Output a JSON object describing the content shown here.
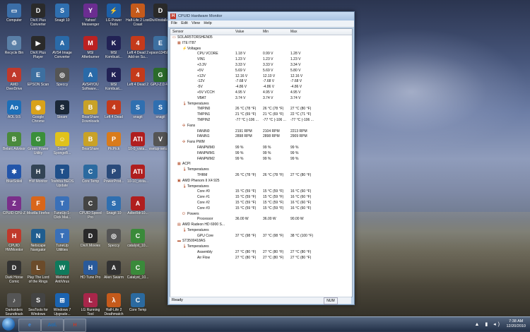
{
  "desktop_icons": [
    {
      "label": "Computer",
      "color": "#3b6ea8",
      "glyph": "▭",
      "col": 0,
      "row": 0
    },
    {
      "label": "Recycle Bin",
      "color": "#5a7fa6",
      "glyph": "♲",
      "col": 0,
      "row": 1
    },
    {
      "label": "AMD OverDrive",
      "color": "#c0392b",
      "glyph": "A",
      "col": 0,
      "row": 2
    },
    {
      "label": "AOL 9.5",
      "color": "#1d6fb8",
      "glyph": "Ao",
      "col": 0,
      "row": 3
    },
    {
      "label": "Belarc Advisor",
      "color": "#4a8a3c",
      "glyph": "B",
      "col": 0,
      "row": 4
    },
    {
      "label": "BlueSoleil",
      "color": "#2255aa",
      "glyph": "✱",
      "col": 0,
      "row": 5
    },
    {
      "label": "CPUID CPU-Z",
      "color": "#7a2f8a",
      "glyph": "Z",
      "col": 0,
      "row": 6
    },
    {
      "label": "CPUID HWMonitor",
      "color": "#c0392b",
      "glyph": "H",
      "col": 0,
      "row": 7
    },
    {
      "label": "Dark Horse Comic",
      "color": "#333333",
      "glyph": "D",
      "col": 0,
      "row": 8
    },
    {
      "label": "Darksiders Soundtrack",
      "color": "#555555",
      "glyph": "♪",
      "col": 0,
      "row": 9
    },
    {
      "label": "DivX Plus Converter",
      "color": "#2a2a2a",
      "glyph": "D",
      "col": 1,
      "row": 0
    },
    {
      "label": "DivX Plus Player",
      "color": "#2a2a2a",
      "glyph": "▶",
      "col": 1,
      "row": 1
    },
    {
      "label": "EPSON Scan",
      "color": "#3d6fa0",
      "glyph": "E",
      "col": 1,
      "row": 2
    },
    {
      "label": "Google Chrome",
      "color": "#d9a21b",
      "glyph": "◉",
      "col": 1,
      "row": 3
    },
    {
      "label": "Green Power Utility",
      "color": "#3a8f3a",
      "glyph": "G",
      "col": 1,
      "row": 4
    },
    {
      "label": "HW Monitor",
      "color": "#345",
      "glyph": "H",
      "col": 1,
      "row": 5
    },
    {
      "label": "Mozilla Firefox",
      "color": "#d9661b",
      "glyph": "F",
      "col": 1,
      "row": 6
    },
    {
      "label": "Netscape Navigator",
      "color": "#1f5d8f",
      "glyph": "N",
      "col": 1,
      "row": 7
    },
    {
      "label": "Play The Lord of the Rings",
      "color": "#6b4b2a",
      "glyph": "L",
      "col": 1,
      "row": 8
    },
    {
      "label": "SeaTools for Windows",
      "color": "#444",
      "glyph": "S",
      "col": 1,
      "row": 9
    },
    {
      "label": "Snagit 10",
      "color": "#2f6fb0",
      "glyph": "S",
      "col": 2,
      "row": 0
    },
    {
      "label": "AVS4 Image Converter",
      "color": "#2a6aa8",
      "glyph": "A",
      "col": 2,
      "row": 1
    },
    {
      "label": "Speccy",
      "color": "#555",
      "glyph": "◎",
      "col": 2,
      "row": 2
    },
    {
      "label": "Steam",
      "color": "#1b2838",
      "glyph": "S",
      "col": 2,
      "row": 3
    },
    {
      "label": "Super SpongeB...",
      "color": "#e0c21b",
      "glyph": "☺",
      "col": 2,
      "row": 4
    },
    {
      "label": "Toshiba BEOS Update",
      "color": "#1f4f8a",
      "glyph": "T",
      "col": 2,
      "row": 5
    },
    {
      "label": "TuneUp 1-Click Mai...",
      "color": "#3a70b8",
      "glyph": "T",
      "col": 2,
      "row": 6
    },
    {
      "label": "TuneUp Utilities",
      "color": "#3a70b8",
      "glyph": "T",
      "col": 2,
      "row": 7
    },
    {
      "label": "Webroot AntiVirus",
      "color": "#0f7a5c",
      "glyph": "W",
      "col": 2,
      "row": 8
    },
    {
      "label": "Windows 7 Upgrade...",
      "color": "#1b63b0",
      "glyph": "⊞",
      "col": 2,
      "row": 9
    },
    {
      "label": "Yahoo! Messenger",
      "color": "#6b2d91",
      "glyph": "Y",
      "col": 3,
      "row": 0
    },
    {
      "label": "MSI Afterburner",
      "color": "#b22",
      "glyph": "M",
      "col": 3,
      "row": 1
    },
    {
      "label": "AVS4YOU Software...",
      "color": "#2a6aa8",
      "glyph": "A",
      "col": 3,
      "row": 2
    },
    {
      "label": "BearShare Downloads",
      "color": "#c9a227",
      "glyph": "B",
      "col": 3,
      "row": 3
    },
    {
      "label": "BearShare",
      "color": "#c9a227",
      "glyph": "B",
      "col": 3,
      "row": 4
    },
    {
      "label": "Core Temp",
      "color": "#2b6aa0",
      "glyph": "C",
      "col": 3,
      "row": 5
    },
    {
      "label": "CPUID Speed Pro",
      "color": "#444",
      "glyph": "C",
      "col": 3,
      "row": 6
    },
    {
      "label": "DivX Movies",
      "color": "#2a2a2a",
      "glyph": "D",
      "col": 3,
      "row": 7
    },
    {
      "label": "HD Tune Pro",
      "color": "#2a5a9a",
      "glyph": "H",
      "col": 3,
      "row": 8
    },
    {
      "label": "LG Running Tool",
      "color": "#a8264a",
      "glyph": "L",
      "col": 3,
      "row": 9
    },
    {
      "label": "LG Power Tools",
      "color": "#1c5fa8",
      "glyph": "⚡",
      "col": 4,
      "row": 0
    },
    {
      "label": "MSI Kombust...",
      "color": "#225",
      "glyph": "K",
      "col": 4,
      "row": 1
    },
    {
      "label": "MSI Kombust...",
      "color": "#225",
      "glyph": "K",
      "col": 4,
      "row": 2
    },
    {
      "label": "Left 4 Dead",
      "color": "#c43a1b",
      "glyph": "4",
      "col": 4,
      "row": 3
    },
    {
      "label": "PicPick",
      "color": "#d97b1b",
      "glyph": "P",
      "col": 4,
      "row": 4
    },
    {
      "label": "PowerProd...",
      "color": "#2a4a7a",
      "glyph": "P",
      "col": 4,
      "row": 5
    },
    {
      "label": "Snagit 10",
      "color": "#2f6fb0",
      "glyph": "S",
      "col": 4,
      "row": 6
    },
    {
      "label": "Speccy",
      "color": "#555",
      "glyph": "◎",
      "col": 4,
      "row": 7
    },
    {
      "label": "Alien Swarm",
      "color": "#333",
      "glyph": "A",
      "col": 4,
      "row": 8
    },
    {
      "label": "Half-Life 2 Deathmatch",
      "color": "#c55a1b",
      "glyph": "λ",
      "col": 4,
      "row": 9
    },
    {
      "label": "Half-Life 2 Lost Coast",
      "color": "#c55a1b",
      "glyph": "λ",
      "col": 5,
      "row": 0
    },
    {
      "label": "Left 4 Dead 2 Add-on Su...",
      "color": "#c43a1b",
      "glyph": "4",
      "col": 5,
      "row": 1
    },
    {
      "label": "Left 4 Dead 2",
      "color": "#c43a1b",
      "glyph": "4",
      "col": 5,
      "row": 2
    },
    {
      "label": "snagit",
      "color": "#2f6fb0",
      "glyph": "S",
      "col": 5,
      "row": 3
    },
    {
      "label": "10-0_vista...",
      "color": "#b01e1e",
      "glyph": "ATI",
      "col": 5,
      "row": 4
    },
    {
      "label": "10-10_vista...",
      "color": "#b01e1e",
      "glyph": "ATI",
      "col": 5,
      "row": 5
    },
    {
      "label": "AdbeRdr10...",
      "color": "#b01e1e",
      "glyph": "A",
      "col": 5,
      "row": 6
    },
    {
      "label": "catalyst_10...",
      "color": "#3a8a3a",
      "glyph": "C",
      "col": 5,
      "row": 7
    },
    {
      "label": "Catalyst_10...",
      "color": "#3a8a3a",
      "glyph": "C",
      "col": 5,
      "row": 8
    },
    {
      "label": "Core Temp",
      "color": "#2b6aa0",
      "glyph": "C",
      "col": 5,
      "row": 9
    },
    {
      "label": "DivXInstalle...",
      "color": "#2a2a2a",
      "glyph": "D",
      "col": 6,
      "row": 0
    },
    {
      "label": "epson13458...",
      "color": "#3d6fa0",
      "glyph": "E",
      "col": 6,
      "row": 1
    },
    {
      "label": "GPU-Z.0.4.4",
      "color": "#2b6b2b",
      "glyph": "G",
      "col": 6,
      "row": 2
    },
    {
      "label": "snagit",
      "color": "#2f6fb0",
      "glyph": "S",
      "col": 6,
      "row": 3
    },
    {
      "label": "vsetup-setup...",
      "color": "#555",
      "glyph": "V",
      "col": 6,
      "row": 4
    }
  ],
  "hwmon": {
    "window_title": "CPUID Hardware Monitor",
    "menu": [
      "File",
      "Edit",
      "View",
      "Help"
    ],
    "columns": {
      "sensor": "Sensor",
      "value": "Value",
      "min": "Min",
      "max": "Max"
    },
    "rows": [
      {
        "indent": 0,
        "icon": "pc-icon",
        "text": "SOLAR5TORSHEN05",
        "value": "",
        "min": "",
        "max": ""
      },
      {
        "indent": 1,
        "icon": "chip-icon",
        "text": "ITE IT87",
        "value": "",
        "min": "",
        "max": ""
      },
      {
        "indent": 2,
        "icon": "voltage-icon",
        "text": "Voltages",
        "value": "",
        "min": "",
        "max": ""
      },
      {
        "indent": 3,
        "icon": "",
        "text": "CPU VCORE",
        "value": "1.18 V",
        "min": "0.99 V",
        "max": "1.28 V"
      },
      {
        "indent": 3,
        "icon": "",
        "text": "VIN1",
        "value": "1.23 V",
        "min": "1.23 V",
        "max": "1.23 V"
      },
      {
        "indent": 3,
        "icon": "",
        "text": "+3.3V",
        "value": "3.33 V",
        "min": "3.33 V",
        "max": "3.34 V"
      },
      {
        "indent": 3,
        "icon": "",
        "text": "+5V",
        "value": "5.69 V",
        "min": "5.69 V",
        "max": "5.80 V"
      },
      {
        "indent": 3,
        "icon": "",
        "text": "+12V",
        "value": "12.16 V",
        "min": "12.10 V",
        "max": "12.16 V"
      },
      {
        "indent": 3,
        "icon": "",
        "text": "-12V",
        "value": "-7.68 V",
        "min": "-7.68 V",
        "max": "-7.68 V"
      },
      {
        "indent": 3,
        "icon": "",
        "text": "-5V",
        "value": "-4.86 V",
        "min": "-4.86 V",
        "max": "-4.86 V"
      },
      {
        "indent": 3,
        "icon": "",
        "text": "+5V VCCH",
        "value": "4.95 V",
        "min": "4.95 V",
        "max": "4.95 V"
      },
      {
        "indent": 3,
        "icon": "",
        "text": "VBAT",
        "value": "3.74 V",
        "min": "3.74 V",
        "max": "3.74 V"
      },
      {
        "indent": 2,
        "icon": "temperature-icon",
        "text": "Temperatures",
        "value": "",
        "min": "",
        "max": ""
      },
      {
        "indent": 3,
        "icon": "",
        "text": "TMPIN0",
        "value": "26 °C (78 °F)",
        "min": "26 °C (78 °F)",
        "max": "27 °C (80 °F)"
      },
      {
        "indent": 3,
        "icon": "",
        "text": "TMPIN1",
        "value": "21 °C (69 °F)",
        "min": "21 °C (69 °F)",
        "max": "22 °C (71 °F)"
      },
      {
        "indent": 3,
        "icon": "",
        "text": "TMPIN2",
        "value": "-77 °C (-106 ...",
        "min": "-77 °C (-106 ...",
        "max": "-77 °C (-106 ..."
      },
      {
        "indent": 2,
        "icon": "fan-icon",
        "text": "Fans",
        "value": "",
        "min": "",
        "max": ""
      },
      {
        "indent": 3,
        "icon": "",
        "text": "FANIN0",
        "value": "2191 RPM",
        "min": "2104 RPM",
        "max": "2213 RPM"
      },
      {
        "indent": 3,
        "icon": "",
        "text": "FANIN1",
        "value": "2898 RPM",
        "min": "2898 RPM",
        "max": "2909 RPM"
      },
      {
        "indent": 2,
        "icon": "fan-pwm-icon",
        "text": "Fans PWM",
        "value": "",
        "min": "",
        "max": ""
      },
      {
        "indent": 3,
        "icon": "",
        "text": "FANPWM0",
        "value": "99 %",
        "min": "99 %",
        "max": "99 %"
      },
      {
        "indent": 3,
        "icon": "",
        "text": "FANPWM1",
        "value": "99 %",
        "min": "99 %",
        "max": "99 %"
      },
      {
        "indent": 3,
        "icon": "",
        "text": "FANPWM2",
        "value": "99 %",
        "min": "99 %",
        "max": "99 %"
      },
      {
        "indent": 1,
        "icon": "chip-icon",
        "text": "ACPI",
        "value": "",
        "min": "",
        "max": ""
      },
      {
        "indent": 2,
        "icon": "temperature-icon",
        "text": "Temperatures",
        "value": "",
        "min": "",
        "max": ""
      },
      {
        "indent": 3,
        "icon": "",
        "text": "THRM",
        "value": "26 °C (78 °F)",
        "min": "26 °C (78 °F)",
        "max": "27 °C (80 °F)"
      },
      {
        "indent": 1,
        "icon": "cpu-icon",
        "text": "AMD Phenom II X4 925",
        "value": "",
        "min": "",
        "max": ""
      },
      {
        "indent": 2,
        "icon": "temperature-icon",
        "text": "Temperatures",
        "value": "",
        "min": "",
        "max": ""
      },
      {
        "indent": 3,
        "icon": "",
        "text": "Core #0",
        "value": "15 °C (59 °F)",
        "min": "15 °C (59 °F)",
        "max": "16 °C (60 °F)"
      },
      {
        "indent": 3,
        "icon": "",
        "text": "Core #1",
        "value": "15 °C (59 °F)",
        "min": "15 °C (59 °F)",
        "max": "16 °C (60 °F)"
      },
      {
        "indent": 3,
        "icon": "",
        "text": "Core #2",
        "value": "15 °C (59 °F)",
        "min": "15 °C (59 °F)",
        "max": "16 °C (60 °F)"
      },
      {
        "indent": 3,
        "icon": "",
        "text": "Core #3",
        "value": "15 °C (59 °F)",
        "min": "15 °C (59 °F)",
        "max": "16 °C (60 °F)"
      },
      {
        "indent": 2,
        "icon": "power-icon",
        "text": "Powers",
        "value": "",
        "min": "",
        "max": ""
      },
      {
        "indent": 3,
        "icon": "",
        "text": "Processor",
        "value": "36.00 W",
        "min": "36.00 W",
        "max": "90.00 W"
      },
      {
        "indent": 1,
        "icon": "gpu-icon",
        "text": "AMD Radeon HD 6900 S...",
        "value": "",
        "min": "",
        "max": ""
      },
      {
        "indent": 2,
        "icon": "temperature-icon",
        "text": "Temperatures",
        "value": "",
        "min": "",
        "max": ""
      },
      {
        "indent": 3,
        "icon": "",
        "text": "GPU Core",
        "value": "37 °C (98 °F)",
        "min": "37 °C (98 °F)",
        "max": "38 °C (100 °F)"
      },
      {
        "indent": 1,
        "icon": "hdd-icon",
        "text": "ST3500418AS",
        "value": "",
        "min": "",
        "max": ""
      },
      {
        "indent": 2,
        "icon": "temperature-icon",
        "text": "Temperatures",
        "value": "",
        "min": "",
        "max": ""
      },
      {
        "indent": 3,
        "icon": "",
        "text": "Assembly",
        "value": "27 °C (80 °F)",
        "min": "27 °C (80 °F)",
        "max": "27 °C (80 °F)"
      },
      {
        "indent": 3,
        "icon": "",
        "text": "Air Flow",
        "value": "27 °C (80 °F)",
        "min": "27 °C (80 °F)",
        "max": "27 °C (80 °F)"
      }
    ],
    "status_ready": "Ready",
    "status_num": "NUM"
  },
  "taskbar": {
    "apps": [
      {
        "name": "internet-explorer-icon",
        "label": "e",
        "color": "#3a8ee6"
      },
      {
        "name": "aol-icon",
        "label": "Aol.",
        "color": "#1d6fb8"
      },
      {
        "name": "hwmonitor-icon",
        "label": "H",
        "color": "#c0392b"
      }
    ],
    "time": "7:38 AM",
    "date": "12/20/2010"
  }
}
